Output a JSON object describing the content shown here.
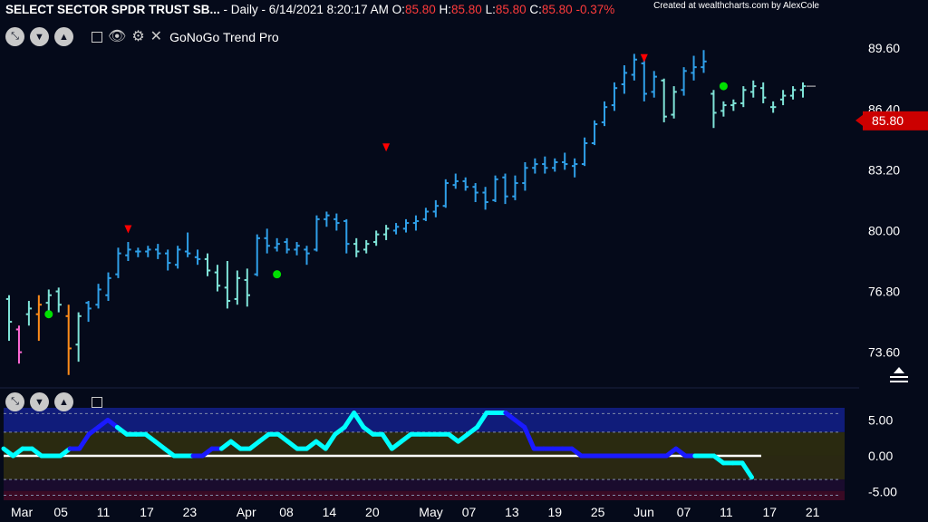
{
  "header": {
    "symbol": "SELECT SECTOR SPDR TRUST SB...",
    "sep": " - ",
    "interval": "Daily",
    "datetime": "6/14/2021 8:20:17 AM",
    "o_label": "O:",
    "o_value": "85.80",
    "h_label": "H:",
    "h_value": "85.80",
    "l_label": "L:",
    "l_value": "85.80",
    "c_label": "C:",
    "c_value": "85.80",
    "change": "-0.37%",
    "credit": "Created at wealthcharts.com by AlexCole"
  },
  "toolbar": {
    "indicator_name": "GoNoGo Trend Pro",
    "icons": [
      "collapse-icon",
      "chevron-down-icon",
      "chevron-up-icon",
      "minimize-icon",
      "eye-icon",
      "gear-icon",
      "close-icon"
    ]
  },
  "colors": {
    "background": "#050a1a",
    "go_strong": "#2f9fe8",
    "go_weak": "#7fe3d8",
    "nogo_amber": "#ff8c1a",
    "nogo_pink": "#ff6ad5",
    "price_badge": "#cc0000",
    "oscillator_up": "#00ffff",
    "oscillator_down": "#1a1aff",
    "dot_green": "#00e000",
    "triangle_red": "#ff0000"
  },
  "chart_data": [
    {
      "type": "ohlc",
      "title": "",
      "price_badge": "85.80",
      "y_ticks": [
        "89.60",
        "86.40",
        "83.20",
        "80.00",
        "76.80",
        "73.60"
      ],
      "y_tick_values": [
        89.6,
        86.4,
        83.2,
        80.0,
        76.8,
        73.6
      ],
      "ylim": [
        72.2,
        90.8
      ],
      "x_ticks": [
        "Mar",
        "05",
        "11",
        "17",
        "23",
        "Apr",
        "08",
        "14",
        "20",
        "May",
        "07",
        "13",
        "19",
        "25",
        "Jun",
        "07",
        "11",
        "17",
        "21"
      ],
      "x_tick_index": [
        0,
        4,
        8,
        12,
        16,
        21,
        25,
        29,
        33,
        38,
        42,
        46,
        50,
        54,
        58,
        62,
        66,
        70,
        74
      ],
      "bars": [
        {
          "o": 76.4,
          "h": 76.6,
          "l": 74.2,
          "c": 75.2,
          "color": "go_weak"
        },
        {
          "o": 74.8,
          "h": 75.0,
          "l": 73.0,
          "c": 73.6,
          "color": "nogo_pink"
        },
        {
          "o": 75.6,
          "h": 76.3,
          "l": 75.0,
          "c": 75.9,
          "color": "go_weak"
        },
        {
          "o": 75.6,
          "h": 76.6,
          "l": 74.2,
          "c": 76.1,
          "color": "nogo_amber"
        },
        {
          "o": 76.2,
          "h": 76.9,
          "l": 75.4,
          "c": 76.6,
          "color": "go_weak"
        },
        {
          "o": 76.8,
          "h": 77.0,
          "l": 75.7,
          "c": 76.1,
          "color": "go_weak"
        },
        {
          "o": 75.5,
          "h": 76.1,
          "l": 72.4,
          "c": 73.8,
          "color": "nogo_amber"
        },
        {
          "o": 74.0,
          "h": 75.7,
          "l": 73.1,
          "c": 75.5,
          "color": "go_weak"
        },
        {
          "o": 76.2,
          "h": 76.3,
          "l": 75.2,
          "c": 75.9,
          "color": "go_strong"
        },
        {
          "o": 76.1,
          "h": 77.2,
          "l": 75.9,
          "c": 76.9,
          "color": "go_strong"
        },
        {
          "o": 76.6,
          "h": 77.8,
          "l": 76.3,
          "c": 77.5,
          "color": "go_strong"
        },
        {
          "o": 77.7,
          "h": 79.1,
          "l": 77.5,
          "c": 78.8,
          "color": "go_strong"
        },
        {
          "o": 78.7,
          "h": 79.4,
          "l": 78.4,
          "c": 79.0,
          "color": "go_strong"
        },
        {
          "o": 78.9,
          "h": 79.1,
          "l": 78.6,
          "c": 78.9,
          "color": "go_strong"
        },
        {
          "o": 78.9,
          "h": 79.2,
          "l": 78.6,
          "c": 79.0,
          "color": "go_strong"
        },
        {
          "o": 79.0,
          "h": 79.3,
          "l": 78.5,
          "c": 78.8,
          "color": "go_strong"
        },
        {
          "o": 78.8,
          "h": 79.0,
          "l": 77.9,
          "c": 78.3,
          "color": "go_strong"
        },
        {
          "o": 78.2,
          "h": 79.2,
          "l": 78.0,
          "c": 79.0,
          "color": "go_strong"
        },
        {
          "o": 78.9,
          "h": 79.9,
          "l": 78.6,
          "c": 78.8,
          "color": "go_strong"
        },
        {
          "o": 78.6,
          "h": 79.0,
          "l": 78.2,
          "c": 78.5,
          "color": "go_strong"
        },
        {
          "o": 78.5,
          "h": 78.8,
          "l": 77.6,
          "c": 77.9,
          "color": "go_weak"
        },
        {
          "o": 77.8,
          "h": 78.2,
          "l": 76.8,
          "c": 77.1,
          "color": "go_weak"
        },
        {
          "o": 77.0,
          "h": 78.4,
          "l": 75.9,
          "c": 76.3,
          "color": "go_weak"
        },
        {
          "o": 76.4,
          "h": 77.9,
          "l": 76.1,
          "c": 77.5,
          "color": "go_weak"
        },
        {
          "o": 77.4,
          "h": 78.0,
          "l": 76.0,
          "c": 76.6,
          "color": "go_weak"
        },
        {
          "o": 77.7,
          "h": 79.8,
          "l": 77.6,
          "c": 79.6,
          "color": "go_strong"
        },
        {
          "o": 79.6,
          "h": 80.1,
          "l": 78.8,
          "c": 79.2,
          "color": "go_strong"
        },
        {
          "o": 79.1,
          "h": 79.6,
          "l": 78.9,
          "c": 79.3,
          "color": "go_strong"
        },
        {
          "o": 79.4,
          "h": 79.6,
          "l": 78.8,
          "c": 79.0,
          "color": "go_strong"
        },
        {
          "o": 79.0,
          "h": 79.4,
          "l": 78.7,
          "c": 79.2,
          "color": "go_strong"
        },
        {
          "o": 79.0,
          "h": 79.2,
          "l": 78.2,
          "c": 78.8,
          "color": "go_strong"
        },
        {
          "o": 79.0,
          "h": 80.8,
          "l": 78.9,
          "c": 80.6,
          "color": "go_strong"
        },
        {
          "o": 80.6,
          "h": 81.0,
          "l": 80.2,
          "c": 80.8,
          "color": "go_strong"
        },
        {
          "o": 80.6,
          "h": 80.9,
          "l": 80.0,
          "c": 80.4,
          "color": "go_strong"
        },
        {
          "o": 80.5,
          "h": 80.6,
          "l": 78.8,
          "c": 79.3,
          "color": "go_strong"
        },
        {
          "o": 79.3,
          "h": 79.6,
          "l": 78.6,
          "c": 78.9,
          "color": "go_weak"
        },
        {
          "o": 79.0,
          "h": 79.5,
          "l": 78.8,
          "c": 79.3,
          "color": "go_weak"
        },
        {
          "o": 79.4,
          "h": 80.0,
          "l": 79.2,
          "c": 79.8,
          "color": "go_weak"
        },
        {
          "o": 79.8,
          "h": 80.3,
          "l": 79.5,
          "c": 80.1,
          "color": "go_weak"
        },
        {
          "o": 80.0,
          "h": 80.4,
          "l": 79.8,
          "c": 80.2,
          "color": "go_strong"
        },
        {
          "o": 80.1,
          "h": 80.6,
          "l": 79.9,
          "c": 80.4,
          "color": "go_strong"
        },
        {
          "o": 80.4,
          "h": 80.8,
          "l": 80.0,
          "c": 80.5,
          "color": "go_strong"
        },
        {
          "o": 80.6,
          "h": 81.2,
          "l": 80.5,
          "c": 81.0,
          "color": "go_strong"
        },
        {
          "o": 81.0,
          "h": 81.6,
          "l": 80.7,
          "c": 81.3,
          "color": "go_strong"
        },
        {
          "o": 81.3,
          "h": 82.7,
          "l": 81.2,
          "c": 82.5,
          "color": "go_strong"
        },
        {
          "o": 82.4,
          "h": 83.0,
          "l": 82.2,
          "c": 82.6,
          "color": "go_strong"
        },
        {
          "o": 82.6,
          "h": 82.8,
          "l": 82.1,
          "c": 82.3,
          "color": "go_strong"
        },
        {
          "o": 82.3,
          "h": 82.5,
          "l": 81.5,
          "c": 82.0,
          "color": "go_strong"
        },
        {
          "o": 82.0,
          "h": 82.3,
          "l": 81.1,
          "c": 81.5,
          "color": "go_strong"
        },
        {
          "o": 81.6,
          "h": 82.9,
          "l": 81.5,
          "c": 82.7,
          "color": "go_strong"
        },
        {
          "o": 82.8,
          "h": 83.0,
          "l": 81.4,
          "c": 81.8,
          "color": "go_strong"
        },
        {
          "o": 81.8,
          "h": 82.9,
          "l": 81.6,
          "c": 82.5,
          "color": "go_strong"
        },
        {
          "o": 82.5,
          "h": 83.6,
          "l": 82.1,
          "c": 83.3,
          "color": "go_strong"
        },
        {
          "o": 83.3,
          "h": 83.8,
          "l": 83.0,
          "c": 83.5,
          "color": "go_strong"
        },
        {
          "o": 83.5,
          "h": 83.9,
          "l": 83.0,
          "c": 83.3,
          "color": "go_strong"
        },
        {
          "o": 83.3,
          "h": 83.8,
          "l": 83.1,
          "c": 83.6,
          "color": "go_strong"
        },
        {
          "o": 83.6,
          "h": 84.1,
          "l": 83.2,
          "c": 83.5,
          "color": "go_strong"
        },
        {
          "o": 83.4,
          "h": 83.8,
          "l": 82.8,
          "c": 83.5,
          "color": "go_strong"
        },
        {
          "o": 83.5,
          "h": 84.9,
          "l": 83.4,
          "c": 84.6,
          "color": "go_strong"
        },
        {
          "o": 84.6,
          "h": 85.8,
          "l": 84.5,
          "c": 85.6,
          "color": "go_strong"
        },
        {
          "o": 85.7,
          "h": 86.8,
          "l": 85.5,
          "c": 86.5,
          "color": "go_strong"
        },
        {
          "o": 86.6,
          "h": 87.8,
          "l": 86.3,
          "c": 87.5,
          "color": "go_strong"
        },
        {
          "o": 87.7,
          "h": 88.7,
          "l": 87.2,
          "c": 88.3,
          "color": "go_strong"
        },
        {
          "o": 88.2,
          "h": 89.3,
          "l": 87.9,
          "c": 89.0,
          "color": "go_strong"
        },
        {
          "o": 88.8,
          "h": 89.1,
          "l": 86.8,
          "c": 87.2,
          "color": "go_strong"
        },
        {
          "o": 87.3,
          "h": 88.4,
          "l": 87.0,
          "c": 88.1,
          "color": "go_strong"
        },
        {
          "o": 87.9,
          "h": 88.0,
          "l": 85.7,
          "c": 86.0,
          "color": "go_weak"
        },
        {
          "o": 86.1,
          "h": 87.6,
          "l": 85.9,
          "c": 87.3,
          "color": "go_weak"
        },
        {
          "o": 87.4,
          "h": 88.6,
          "l": 87.1,
          "c": 88.4,
          "color": "go_strong"
        },
        {
          "o": 88.3,
          "h": 89.2,
          "l": 87.9,
          "c": 88.6,
          "color": "go_strong"
        },
        {
          "o": 88.6,
          "h": 89.5,
          "l": 88.3,
          "c": 88.9,
          "color": "go_strong"
        },
        {
          "o": 87.2,
          "h": 87.4,
          "l": 85.4,
          "c": 86.2,
          "color": "go_weak"
        },
        {
          "o": 86.3,
          "h": 86.8,
          "l": 86.0,
          "c": 86.6,
          "color": "go_weak"
        },
        {
          "o": 86.6,
          "h": 86.9,
          "l": 86.3,
          "c": 86.7,
          "color": "go_weak"
        },
        {
          "o": 86.7,
          "h": 87.6,
          "l": 86.5,
          "c": 87.4,
          "color": "go_weak"
        },
        {
          "o": 87.3,
          "h": 87.9,
          "l": 87.0,
          "c": 87.6,
          "color": "go_weak"
        },
        {
          "o": 87.5,
          "h": 87.8,
          "l": 86.7,
          "c": 87.0,
          "color": "go_weak"
        },
        {
          "o": 86.5,
          "h": 86.8,
          "l": 86.2,
          "c": 86.5,
          "color": "go_weak"
        },
        {
          "o": 86.9,
          "h": 87.4,
          "l": 86.6,
          "c": 87.1,
          "color": "go_weak"
        },
        {
          "o": 87.1,
          "h": 87.6,
          "l": 86.9,
          "c": 87.4,
          "color": "go_weak"
        },
        {
          "o": 87.4,
          "h": 87.8,
          "l": 87.0,
          "c": 87.6,
          "color": "go_weak"
        }
      ],
      "trend_start_index": 0,
      "green_dots": [
        {
          "index": 4,
          "price": 75.6
        },
        {
          "index": 27,
          "price": 77.7
        },
        {
          "index": 72,
          "price": 87.6
        }
      ],
      "red_triangles": [
        {
          "index": 12,
          "price": 80.0
        },
        {
          "index": 38,
          "price": 84.3
        },
        {
          "index": 64,
          "price": 89.0
        }
      ]
    },
    {
      "type": "line",
      "title": "",
      "y_ticks": [
        "5.00",
        "0.00",
        "-5.00"
      ],
      "y_tick_values": [
        5,
        0,
        -5
      ],
      "ylim": [
        -6.2,
        6.7
      ],
      "zero_line": 0
    }
  ]
}
